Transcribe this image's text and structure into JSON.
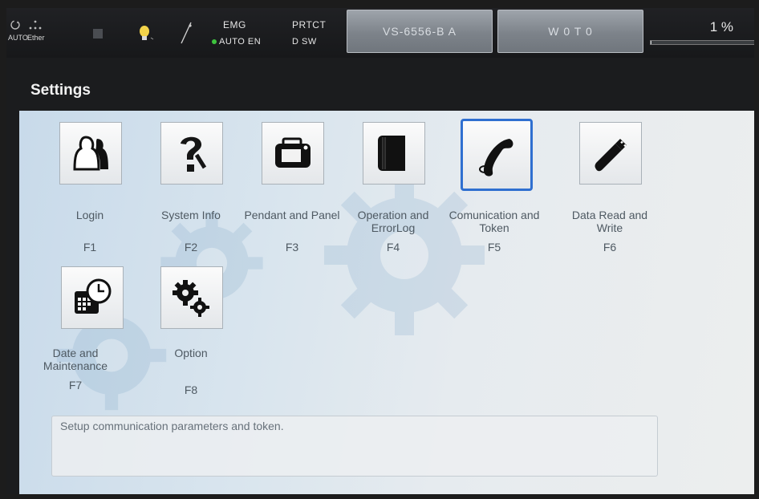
{
  "status_bar": {
    "mode_label": "AUTO",
    "network_label": "Ether",
    "emg_label": "EMG",
    "auto_en_label": "AUTO EN",
    "prtct_label": "PRTCT",
    "dsw_label": "D SW",
    "robot_model_button": "VS-6556-B A",
    "work_button": "W 0 T 0",
    "speed_override": "1 %",
    "speed_override_fraction": 0.01
  },
  "page": {
    "title": "Settings"
  },
  "menu_items": [
    {
      "name": "login",
      "label": "Login",
      "key": "F1",
      "icon": "users-icon"
    },
    {
      "name": "system-info",
      "label": "System Info",
      "key": "F2",
      "icon": "question-robot-icon"
    },
    {
      "name": "pendant-panel",
      "label": "Pendant and Panel",
      "key": "F3",
      "icon": "pendant-icon"
    },
    {
      "name": "operation-errorlog",
      "label": "Operation and ErrorLog",
      "key": "F4",
      "icon": "book-icon"
    },
    {
      "name": "communication-token",
      "label": "Comunication and Token",
      "key": "F5",
      "icon": "phone-handset-icon",
      "selected": true
    },
    {
      "name": "data-read-write",
      "label": "Data Read and Write",
      "key": "F6",
      "icon": "usb-stick-icon"
    },
    {
      "name": "date-maintenance",
      "label": "Date and Maintenance",
      "key": "F7",
      "icon": "calendar-clock-icon"
    },
    {
      "name": "option",
      "label": "Option",
      "key": "F8",
      "icon": "gears-icon"
    }
  ],
  "description": {
    "text": "Setup communication parameters and token."
  },
  "colors": {
    "selection_border": "#2f6fd0",
    "status_led": "#3ec43e"
  }
}
